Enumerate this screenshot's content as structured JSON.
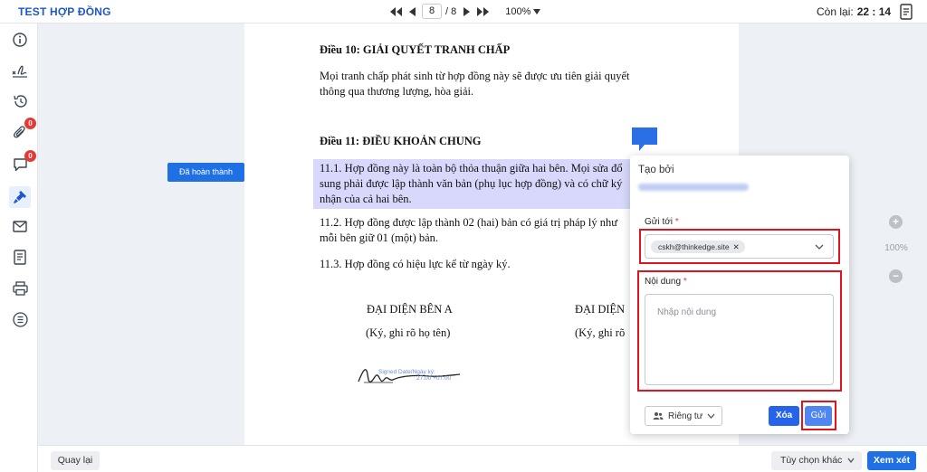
{
  "header": {
    "title": "TEST HỢP ĐỒNG",
    "current_page": "8",
    "total_pages": "/ 8",
    "zoom": "100%",
    "remaining_label": "Còn lại:",
    "remaining_time": "22 : 14"
  },
  "sidebar": {
    "attachments_badge": "0",
    "comments_badge": "0",
    "icons": [
      "info-icon",
      "signature-icon",
      "history-icon",
      "attachment-icon",
      "comment-icon",
      "stamp-icon",
      "mail-icon",
      "document-icon",
      "print-icon",
      "list-icon"
    ]
  },
  "document": {
    "article10_title": "Điều 10: GIẢI QUYẾT TRANH CHẤP",
    "article10_line1": "Mọi tranh chấp phát sinh từ hợp đồng này sẽ được ưu tiên giải quyết",
    "article10_line2": "thông qua thương lượng, hòa giải.",
    "article11_title": "Điều 11: ĐIỀU KHOẢN CHUNG",
    "p111_line1": "11.1. Hợp đồng này là toàn bộ thỏa thuận giữa hai bên. Mọi sửa đổ",
    "p111_line2": "sung phải được lập thành văn bản (phụ lục hợp đồng) và có chữ ký",
    "p111_line3": "nhận của cả hai bên.",
    "p112_line1": "11.2. Hợp đồng được lập thành 02 (hai) bản có giá trị pháp lý như",
    "p112_line2": "mỗi bên giữ 01 (một) bản.",
    "p113": "11.3. Hợp đồng có hiệu lực kể từ ngày ký.",
    "rep_a": "ĐẠI DIỆN BÊN A",
    "rep_a_sub": "(Ký, ghi rõ họ tên)",
    "rep_b": "ĐẠI DIỆN",
    "rep_b_sub": "(Ký, ghi rõ",
    "sig_text1": "Signed Date/Ngày ký:",
    "sig_text2": "27.00 +07:00"
  },
  "done_button": "Đã hoàn thành",
  "zoom_panel": {
    "value": "100%"
  },
  "comment_popup": {
    "created_by_label": "Tạo bởi",
    "send_to_label": "Gửi tới",
    "recipient_chip": "cskh@thinkedge.site",
    "content_label": "Nội dung",
    "content_placeholder": "Nhập nội dung",
    "privacy_label": "Riêng tư",
    "clear_button": "Xóa",
    "send_button": "Gửi",
    "required_mark": "*"
  },
  "footer": {
    "back_button": "Quay lại",
    "options_select": "Tùy chọn khác",
    "review_button": "Xem xét"
  },
  "colors": {
    "brand_blue": "#1f6fe5",
    "title_blue": "#1f57c8",
    "highlight": "#d7d8fb",
    "annotation_red": "#e0141e",
    "badge_red": "#e53935"
  }
}
